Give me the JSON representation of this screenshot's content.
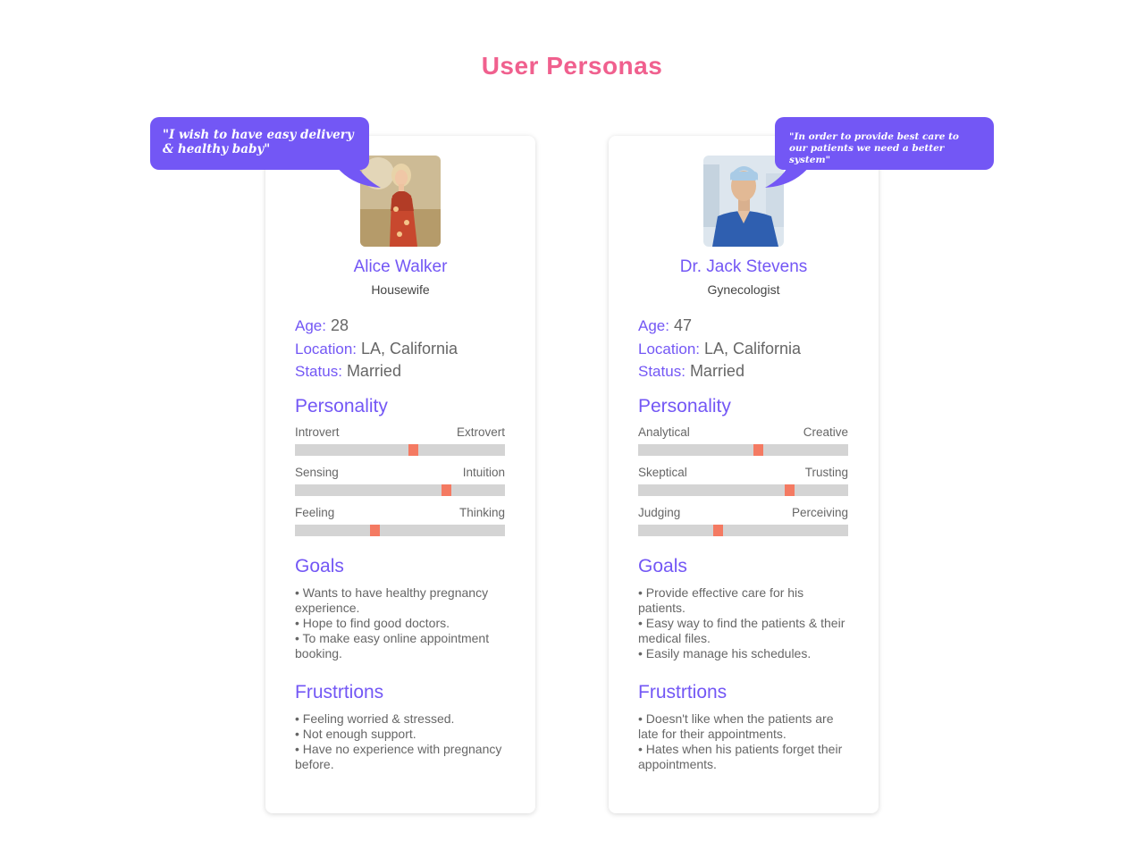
{
  "page": {
    "title": "User Personas"
  },
  "personas": [
    {
      "quote": "\"I wish to have easy delivery & healthy baby\"",
      "name": "Alice Walker",
      "role": "Housewife",
      "age_label": "Age:",
      "age": "28",
      "location_label": "Location:",
      "location": "LA, California",
      "status_label": "Status:",
      "status": "Married",
      "personality_title": "Personality",
      "sliders": [
        {
          "left": "Introvert",
          "right": "Extrovert",
          "value": 0.56
        },
        {
          "left": "Sensing",
          "right": "Intuition",
          "value": 0.72
        },
        {
          "left": "Feeling",
          "right": "Thinking",
          "value": 0.38
        }
      ],
      "goals_title": "Goals",
      "goals": [
        "• Wants to have healthy pregnancy experience.",
        "• Hope to find good doctors.",
        "• To make easy online appointment booking."
      ],
      "frustrations_title": "Frustrtions",
      "frustrations": [
        "• Feeling worried & stressed.",
        "• Not enough support.",
        "• Have no experience with pregnancy before."
      ],
      "photo_icon": "woman-portrait-photo",
      "colors": {
        "dress": "#c8482e",
        "hair": "#e8d3a8",
        "bg": "#c9b48e"
      }
    },
    {
      "quote": "\"In order to provide best care to our patients we need a better system\"",
      "name": "Dr. Jack Stevens",
      "role": "Gynecologist",
      "age_label": "Age:",
      "age": "47",
      "location_label": "Location:",
      "location": "LA, California",
      "status_label": "Status:",
      "status": "Married",
      "personality_title": "Personality",
      "sliders": [
        {
          "left": "Analytical",
          "right": "Creative",
          "value": 0.57
        },
        {
          "left": "Skeptical",
          "right": "Trusting",
          "value": 0.72
        },
        {
          "left": "Judging",
          "right": "Perceiving",
          "value": 0.38
        }
      ],
      "goals_title": "Goals",
      "goals": [
        "• Provide effective care for his patients.",
        "• Easy way to find the patients & their medical files.",
        "• Easily manage his schedules."
      ],
      "frustrations_title": "Frustrtions",
      "frustrations": [
        "• Doesn't like when the patients are late for their appointments.",
        "• Hates when his patients forget their appointments."
      ],
      "photo_icon": "doctor-portrait-photo",
      "colors": {
        "scrubs": "#2f5fb0",
        "cap": "#a9cbe6",
        "bg": "#dde6ee"
      }
    }
  ],
  "colors": {
    "accent": "#7357f5",
    "title": "#f0608e",
    "marker": "#f47a62",
    "track": "#d4d4d4"
  }
}
